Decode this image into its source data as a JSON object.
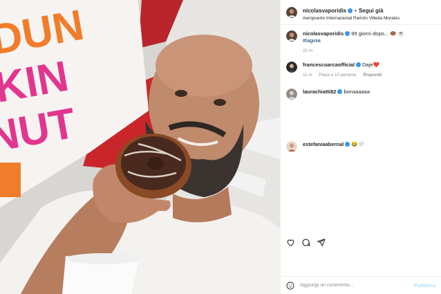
{
  "post": {
    "author": "nicolasvaporidis",
    "follow_label": "Segui già",
    "separator": "•",
    "location": "Aeropuerto Internacional Ramón Villeda Morales"
  },
  "caption": {
    "username": "nicolasvaporidis",
    "text": "99 giorni dopo... 🍩 ☕",
    "hashtag": "#lagioia",
    "time": "22 m"
  },
  "comments": [
    {
      "username": "francescoarcaofficial",
      "text": "Daje❤️",
      "time": "11 m",
      "likes": "Piace a 12 persone",
      "reply": "Rispondi"
    },
    {
      "username": "laurachiatti82",
      "text": "bonaaaaaa"
    },
    {
      "username": "estefaniaabernal",
      "text": "😂🤍"
    }
  ],
  "actions": {
    "like_icon": "heart-icon",
    "comment_icon": "comment-icon",
    "share_icon": "share-icon"
  },
  "composer": {
    "placeholder": "Aggiungi un commento...",
    "post_label": "Pubblica"
  },
  "colors": {
    "verified": "#3897f0",
    "hashtag": "#00376b",
    "muted": "#8e8e8e",
    "post_disabled": "#b2dffc",
    "dunkin_orange": "#f07d2b",
    "dunkin_pink": "#e1368f"
  }
}
